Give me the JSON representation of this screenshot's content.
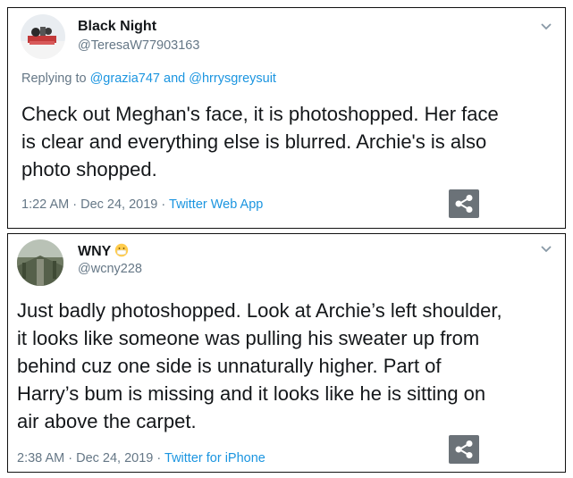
{
  "tweets": [
    {
      "display_name": "Black Night",
      "handle": "@TeresaW77903163",
      "reply_prefix": "Replying to",
      "reply_mention_1": "@grazia747",
      "reply_and": "and",
      "reply_mention_2": "@hrrysgreysuit",
      "text_lines": [
        "Check out Meghan's face, it is photoshopped. Her face",
        "is clear and everything else is blurred.  Archie's is also",
        "photo shopped."
      ],
      "time": "1:22 AM",
      "date": "Dec 24, 2019",
      "source": "Twitter Web App",
      "separator": "·"
    },
    {
      "display_name": "WNY",
      "handle": "@wcny228",
      "name_emoji_icon": "face-with-medical-mask-icon",
      "text_lines": [
        "Just badly photoshopped. Look at Archie’s left shoulder,",
        "it looks like someone was pulling his sweater up from",
        "behind cuz one side is unnaturally higher. Part of",
        "Harry’s bum is missing and it looks like he is sitting on",
        "air above the carpet."
      ],
      "time": "2:38 AM",
      "date": "Dec 24, 2019",
      "source": "Twitter for iPhone",
      "separator": "·"
    }
  ],
  "icons": {
    "menu": "chevron-down-icon",
    "share": "share-icon"
  },
  "colors": {
    "link": "#1b95e0",
    "secondary_text": "#657786",
    "primary_text": "#14171a",
    "share_button": "#6b7278"
  }
}
